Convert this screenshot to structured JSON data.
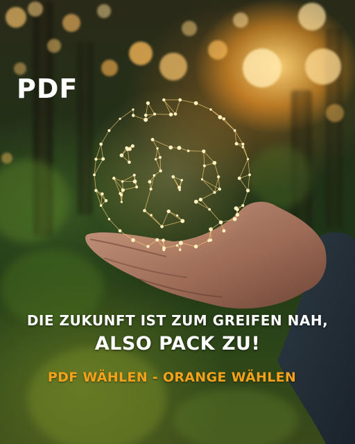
{
  "title": "PDF",
  "headline": {
    "line1": "DIE ZUKUNFT IST ZUM GREIFEN NAH,",
    "line2": "ALSO PACK ZU!"
  },
  "cta": "PDF WÄHLEN - ORANGE WÄHLEN",
  "colors": {
    "title": "#ffffff",
    "headline": "#ffffff",
    "cta": "#f5a21b",
    "glow": "#ffc94d"
  }
}
